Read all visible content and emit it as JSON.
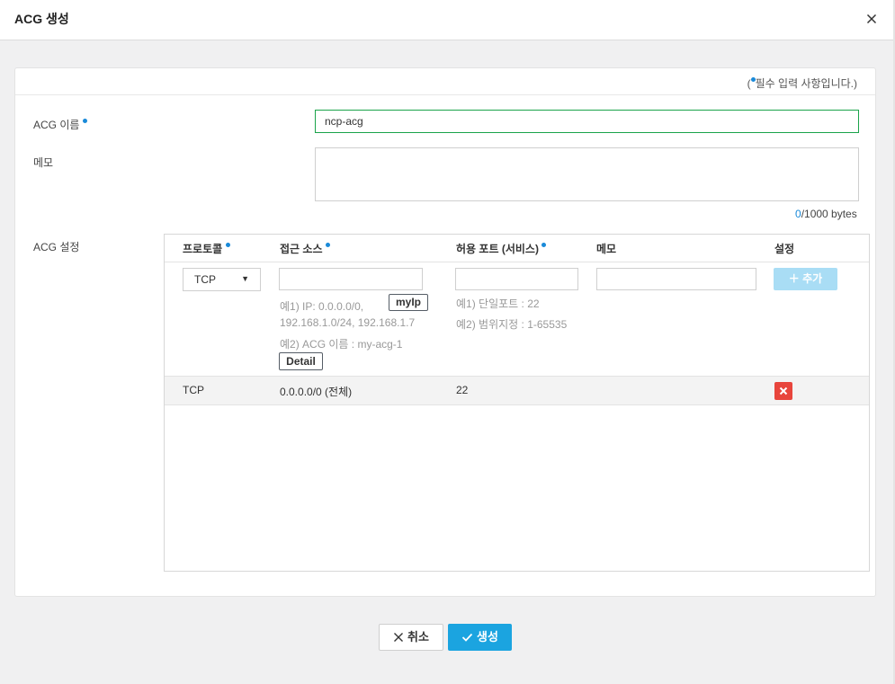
{
  "dialog": {
    "title": "ACG 생성"
  },
  "form": {
    "required_note_prefix": "(",
    "required_note_text": "필수 입력 사항입니다.)",
    "acg_name_label": "ACG 이름",
    "acg_name_value": "ncp-acg",
    "memo_label": "메모",
    "memo_value": "",
    "counter_current": "0",
    "counter_rest": "/1000 bytes",
    "acg_settings_label": "ACG 설정"
  },
  "rules_table": {
    "headers": {
      "protocol": "프로토콜",
      "source": "접근 소스",
      "port": "허용 포트 (서비스)",
      "memo": "메모",
      "settings": "설정"
    },
    "new_rule": {
      "protocol_selected": "TCP",
      "source_value": "",
      "port_value": "",
      "memo_value": "",
      "source_hint_1a": "예1) IP: 0.0.0.0/0,",
      "source_hint_1b": "192.168.1.0/24, 192.168.1.7",
      "source_hint_2": "예2) ACG 이름 : my-acg-1",
      "myip_button": "myIp",
      "detail_button": "Detail",
      "port_hint_1": "예1) 단일포트 : 22",
      "port_hint_2": "예2) 범위지정 : 1-65535",
      "add_button": "추가"
    },
    "rows": [
      {
        "protocol": "TCP",
        "source": "0.0.0.0/0 (전체)",
        "port": "22"
      }
    ]
  },
  "footer": {
    "cancel_label": "취소",
    "create_label": "생성"
  },
  "colors": {
    "accent": "#1ba4e0",
    "required_dot": "#1a8ad9",
    "focus_border": "#1aa34a",
    "delete": "#e8453c",
    "add_disabled": "#a9ddf5"
  }
}
